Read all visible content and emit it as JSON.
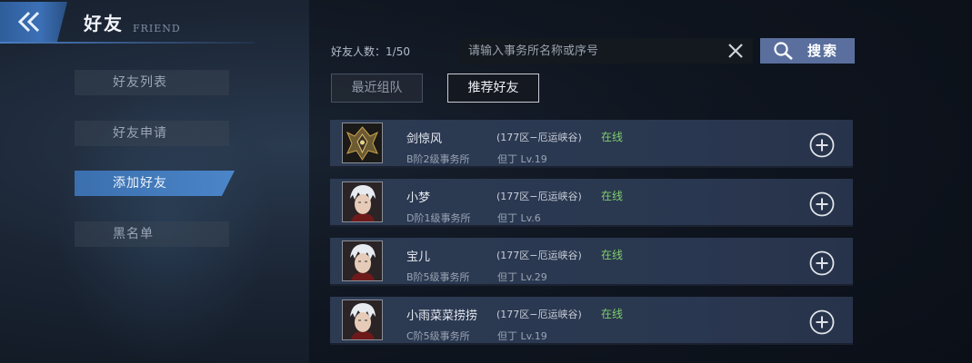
{
  "header": {
    "title": "好友",
    "subtitle": "FRIEND"
  },
  "sidebar": {
    "items": [
      {
        "label": "好友列表",
        "active": false
      },
      {
        "label": "好友申请",
        "active": false
      },
      {
        "label": "添加好友",
        "active": true
      },
      {
        "label": "黑名单",
        "active": false
      }
    ]
  },
  "friend_count": {
    "label": "好友人数：",
    "value": "1/50"
  },
  "search": {
    "placeholder": "请输入事务所名称或序号",
    "button_label": "搜索"
  },
  "tabs": [
    {
      "label": "最近组队",
      "active": false
    },
    {
      "label": "推荐好友",
      "active": true
    }
  ],
  "friends": [
    {
      "name": "剑惊风",
      "server": "(177区−厄运峡谷)",
      "status": "在线",
      "guild": "B阶2级事务所",
      "level": "但丁 Lv.19",
      "avatar": "mech-knight-avatar"
    },
    {
      "name": "小梦",
      "server": "(177区−厄运峡谷)",
      "status": "在线",
      "guild": "D阶1级事务所",
      "level": "但丁 Lv.6",
      "avatar": "white-hair-avatar"
    },
    {
      "name": "宝儿",
      "server": "(177区−厄运峡谷)",
      "status": "在线",
      "guild": "B阶5级事务所",
      "level": "但丁 Lv.29",
      "avatar": "white-hair-avatar"
    },
    {
      "name": "小雨菜菜捞捞",
      "server": "(177区−厄运峡谷)",
      "status": "在线",
      "guild": "C阶5级事务所",
      "level": "但丁 Lv.19",
      "avatar": "white-hair-avatar"
    }
  ],
  "colors": {
    "accent": "#3c70b6",
    "online": "#7fcf6a",
    "search_button": "#5a6f9e"
  }
}
